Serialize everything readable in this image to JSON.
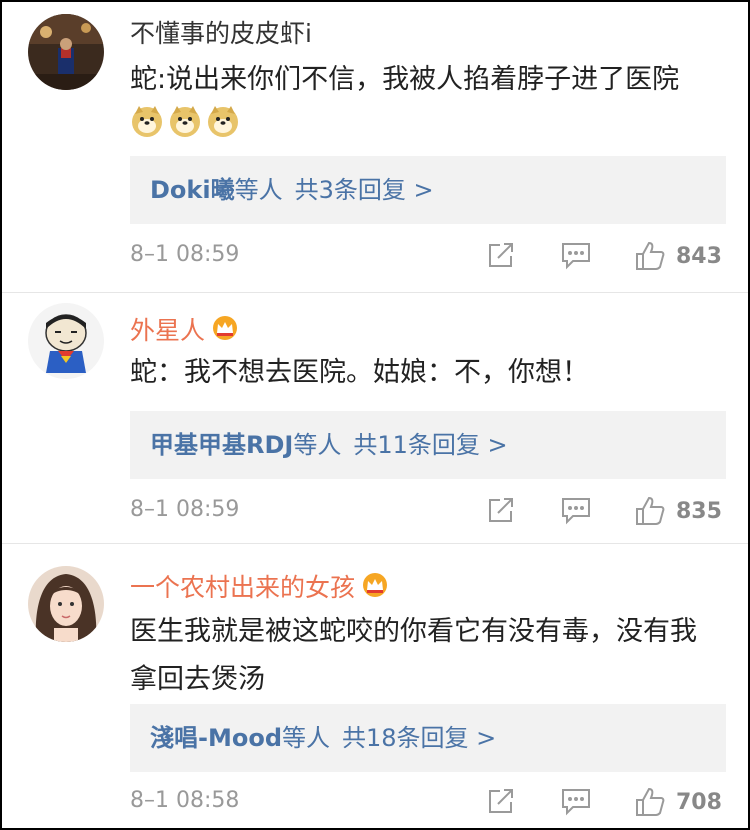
{
  "comments": [
    {
      "username": "不懂事的皮皮虾i",
      "vip": false,
      "text": "蛇:说出来你们不信，我被人掐着脖子进了医院",
      "emojis": [
        "doge-emoji",
        "doge-emoji",
        "doge-emoji"
      ],
      "reply_names": "Doki曦",
      "reply_suffix": "等人",
      "reply_count": "共3条回复 >",
      "time": "8–1 08:59",
      "likes": "843"
    },
    {
      "username": "外星人",
      "vip": true,
      "text": "蛇：我不想去医院。姑娘：不，你想！",
      "reply_names": "甲基甲基RDJ",
      "reply_suffix": "等人",
      "reply_count": "共11条回复 >",
      "time": "8–1 08:59",
      "likes": "835"
    },
    {
      "username": "一个农村出来的女孩",
      "vip": true,
      "text": "医生我就是被这蛇咬的你看它有没有毒，没有我拿回去煲汤",
      "reply_names": "淺唱-Mood",
      "reply_suffix": "等人",
      "reply_count": "共18条回复 >",
      "time": "8–1 08:58",
      "likes": "708"
    }
  ],
  "colors": {
    "username_vip": "#eb7350",
    "reply_link": "#4a73a6",
    "meta_gray": "#999999",
    "reply_bg": "#f2f2f2"
  }
}
